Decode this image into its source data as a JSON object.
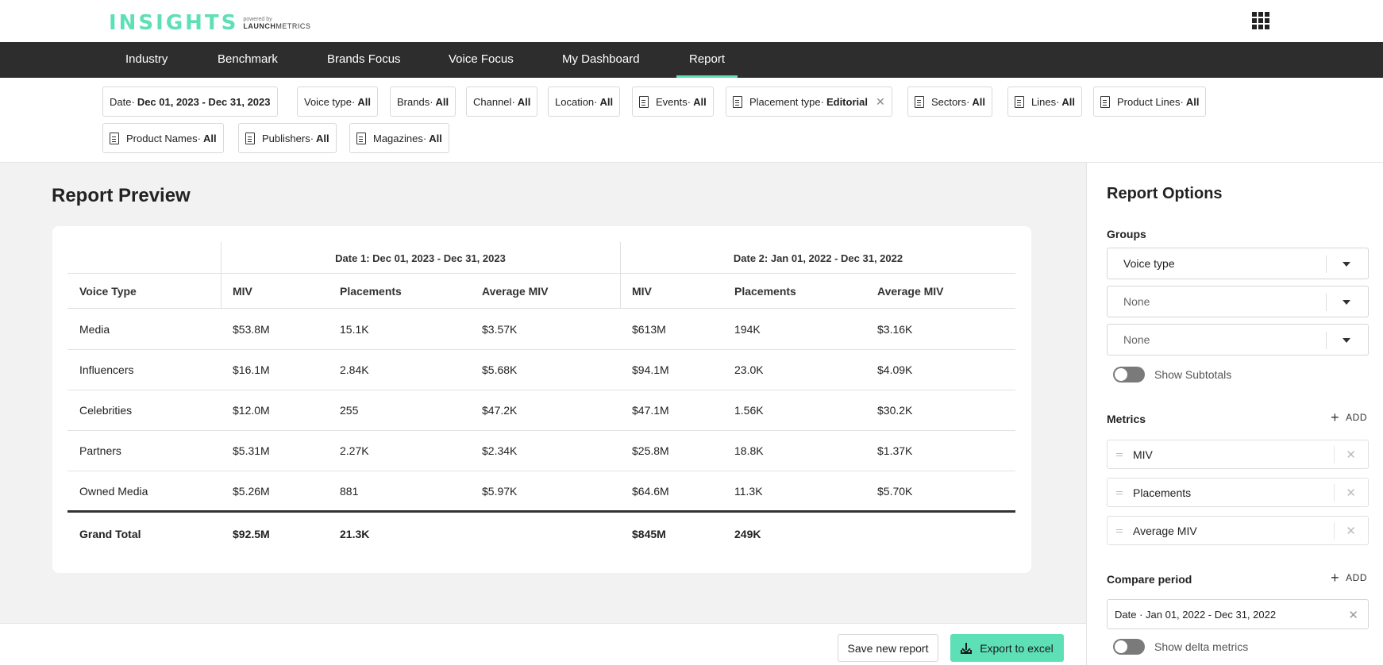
{
  "header": {
    "logo_main": "INSIGHTS",
    "logo_powered": "powered by",
    "logo_brand_bold": "LAUNCH",
    "logo_brand_light": "METRICS"
  },
  "nav": {
    "items": [
      "Industry",
      "Benchmark",
      "Brands Focus",
      "Voice Focus",
      "My Dashboard",
      "Report"
    ],
    "active": "Report"
  },
  "filters": [
    {
      "label": "Date",
      "value": "Dec 01, 2023 - Dec 31, 2023",
      "icon": false
    },
    {
      "label": "Voice type",
      "value": "All",
      "icon": false
    },
    {
      "label": "Brands",
      "value": "All",
      "icon": false
    },
    {
      "label": "Channel",
      "value": "All",
      "icon": false
    },
    {
      "label": "Location",
      "value": "All",
      "icon": false
    },
    {
      "label": "Events",
      "value": "All",
      "icon": "document-icon"
    },
    {
      "label": "Placement type",
      "value": "Editorial",
      "icon": "document-icon",
      "removable": true
    },
    {
      "label": "Sectors",
      "value": "All",
      "icon": "document-icon"
    },
    {
      "label": "Lines",
      "value": "All",
      "icon": "document-icon"
    },
    {
      "label": "Product Lines",
      "value": "All",
      "icon": "document-icon"
    },
    {
      "label": "Product Names",
      "value": "All",
      "icon": "document-icon"
    },
    {
      "label": "Publishers",
      "value": "All",
      "icon": "document-icon"
    },
    {
      "label": "Magazines",
      "value": "All",
      "icon": "document-icon"
    }
  ],
  "filter_separator": " · ",
  "main": {
    "title": "Report Preview",
    "table": {
      "group1": "Date 1: Dec 01, 2023 - Dec 31, 2023",
      "group2": "Date 2: Jan 01, 2022 - Dec 31, 2022",
      "headers": [
        "Voice Type",
        "MIV",
        "Placements",
        "Average MIV",
        "MIV",
        "Placements",
        "Average MIV"
      ],
      "rows": [
        [
          "Media",
          "$53.8M",
          "15.1K",
          "$3.57K",
          "$613M",
          "194K",
          "$3.16K"
        ],
        [
          "Influencers",
          "$16.1M",
          "2.84K",
          "$5.68K",
          "$94.1M",
          "23.0K",
          "$4.09K"
        ],
        [
          "Celebrities",
          "$12.0M",
          "255",
          "$47.2K",
          "$47.1M",
          "1.56K",
          "$30.2K"
        ],
        [
          "Partners",
          "$5.31M",
          "2.27K",
          "$2.34K",
          "$25.8M",
          "18.8K",
          "$1.37K"
        ],
        [
          "Owned Media",
          "$5.26M",
          "881",
          "$5.97K",
          "$64.6M",
          "11.3K",
          "$5.70K"
        ]
      ],
      "total": [
        "Grand Total",
        "$92.5M",
        "21.3K",
        "",
        "$845M",
        "249K",
        ""
      ]
    }
  },
  "footer": {
    "save_label": "Save new report",
    "export_label": "Export to excel"
  },
  "side": {
    "title": "Report Options",
    "groups_label": "Groups",
    "groups": [
      "Voice type",
      "None",
      "None"
    ],
    "subtotals_label": "Show Subtotals",
    "metrics_label": "Metrics",
    "add_label": "ADD",
    "metrics": [
      "MIV",
      "Placements",
      "Average MIV"
    ],
    "compare_label": "Compare period",
    "compare_value": "Date · Jan 01, 2022 - Dec 31, 2022",
    "delta_label": "Show delta metrics"
  },
  "colors": {
    "accent": "#5ee0b6",
    "nav_bg": "#2d2d2d",
    "main_bg": "#f2f2f2"
  }
}
